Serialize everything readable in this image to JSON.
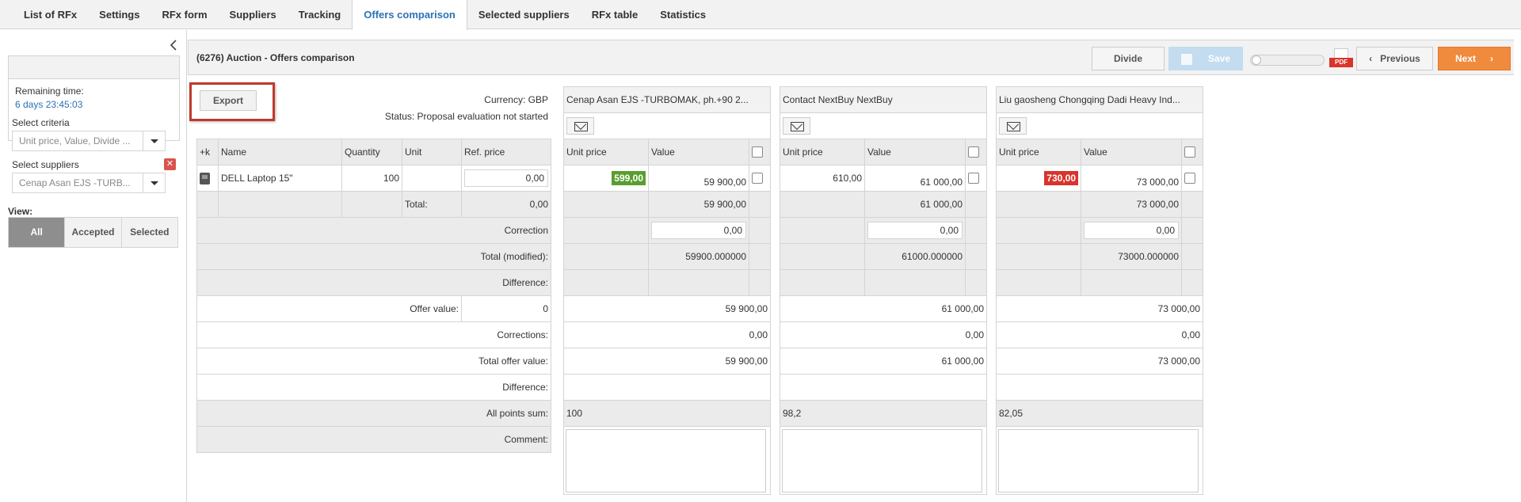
{
  "tabs": [
    "List of RFx",
    "Settings",
    "RFx form",
    "Suppliers",
    "Tracking",
    "Offers comparison",
    "Selected suppliers",
    "RFx table",
    "Statistics"
  ],
  "active_tab": "Offers comparison",
  "sidebar": {
    "remaining_label": "Remaining time:",
    "remaining_value": "6 days 23:45:03",
    "criteria_label": "Select criteria",
    "criteria_value": "Unit price, Value, Divide ...",
    "suppliers_label": "Select suppliers",
    "suppliers_value": "Cenap Asan EJS -TURB...",
    "view_label": "View:",
    "view_options": [
      "All",
      "Accepted",
      "Selected"
    ]
  },
  "header": {
    "title": "(6276) Auction - Offers comparison",
    "divide": "Divide",
    "save": "Save",
    "previous": "Previous",
    "next": "Next",
    "pdf": "PDF"
  },
  "export_label": "Export",
  "currency": "Currency: GBP",
  "status": "Status: Proposal evaluation not started",
  "grid": {
    "headers": [
      "+k",
      "Name",
      "Quantity",
      "Unit",
      "Ref. price"
    ],
    "item": {
      "name": "DELL Laptop 15\"",
      "quantity": "100",
      "unit": "",
      "ref_price": "0,00"
    },
    "total_label": "Total:",
    "total_value": "0,00",
    "correction_label": "Correction",
    "total_modified_label": "Total (modified):",
    "difference_label": "Difference:",
    "offer_value_label": "Offer value:",
    "offer_value": "0",
    "corrections_label": "Corrections:",
    "total_offer_label": "Total offer value:",
    "difference2_label": "Difference:",
    "points_label": "All points sum:",
    "comment_label": "Comment:"
  },
  "supplier_headers": [
    "Unit price",
    "Value"
  ],
  "suppliers": [
    {
      "name": "Cenap Asan EJS -TURBOMAK, ph.+90 2...",
      "unit_price": "599,00",
      "value": "59 900,00",
      "total": "59 900,00",
      "correction": "0,00",
      "total_modified": "59900.000000",
      "offer_value": "59 900,00",
      "corrections": "0,00",
      "total_offer": "59 900,00",
      "points": "100",
      "badge_color": "#5a9e2f"
    },
    {
      "name": "Contact NextBuy NextBuy",
      "unit_price": "610,00",
      "value": "61 000,00",
      "total": "61 000,00",
      "correction": "0,00",
      "total_modified": "61000.000000",
      "offer_value": "61 000,00",
      "corrections": "0,00",
      "total_offer": "61 000,00",
      "points": "98,2",
      "badge_color": ""
    },
    {
      "name": "Liu gaosheng Chongqing Dadi Heavy Ind...",
      "unit_price": "730,00",
      "value": "73 000,00",
      "total": "73 000,00",
      "correction": "0,00",
      "total_modified": "73000.000000",
      "offer_value": "73 000,00",
      "corrections": "0,00",
      "total_offer": "73 000,00",
      "points": "82,05",
      "badge_color": "#d9342b"
    }
  ]
}
